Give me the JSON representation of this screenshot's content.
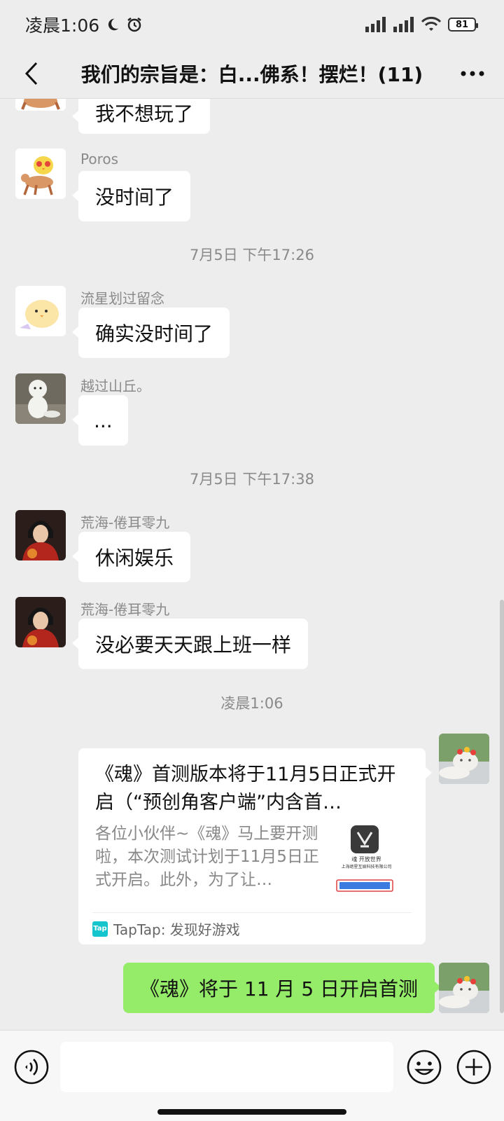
{
  "status_bar": {
    "time": "凌晨1:06",
    "battery": "81",
    "icons": [
      "moon-icon",
      "alarm-icon",
      "signal-icon",
      "signal-icon",
      "wifi-icon",
      "battery-icon"
    ]
  },
  "nav": {
    "title": "我们的宗旨是：白...佛系！摆烂！(11)",
    "back_icon": "back-arrow-icon",
    "more_icon": "more-icon"
  },
  "messages": [
    {
      "sender": "",
      "text": "我不想玩了",
      "avatar": "chick-on-horse-avatar"
    },
    {
      "sender": "Poros",
      "text": "没时间了",
      "avatar": "chick-on-horse-avatar"
    },
    {
      "timestamp": "7月5日 下午17:26"
    },
    {
      "sender": "流星划过留念",
      "text": "确实没时间了",
      "avatar": "yellow-chick-avatar"
    },
    {
      "sender": "越过山丘。",
      "text": "...",
      "avatar": "plush-doll-avatar"
    },
    {
      "timestamp": "7月5日 下午17:38"
    },
    {
      "sender": "荒海-倦耳零九",
      "text": "休闲娱乐",
      "avatar": "anime-character-avatar"
    },
    {
      "sender": "荒海-倦耳零九",
      "text": "没必要天天跟上班一样",
      "avatar": "anime-character-avatar"
    },
    {
      "timestamp": "凌晨1:06"
    }
  ],
  "link_card": {
    "title": "《魂》首测版本将于11月5日正式开启（“预创角客户端”内含首…",
    "description": "各位小伙伴~《魂》马上要开测啦，本次测试计划于11月5日正式开启。此外，为了让…",
    "source": "TapTap: 发现好游戏",
    "source_logo": "Tap",
    "thumb_caption": "魂 开放世界",
    "thumb_company": "上海绝星互娱科技有限公司"
  },
  "my_message": {
    "text": "《魂》将于 11 月 5 日开启首测",
    "avatar": "cat-avatar"
  },
  "input_bar": {
    "placeholder": "",
    "voice_icon": "voice-icon",
    "emoji_icon": "emoji-icon",
    "plus_icon": "plus-icon"
  },
  "colors": {
    "background": "#ededed",
    "my_bubble": "#95ec69",
    "taptap": "#15c5ce"
  }
}
